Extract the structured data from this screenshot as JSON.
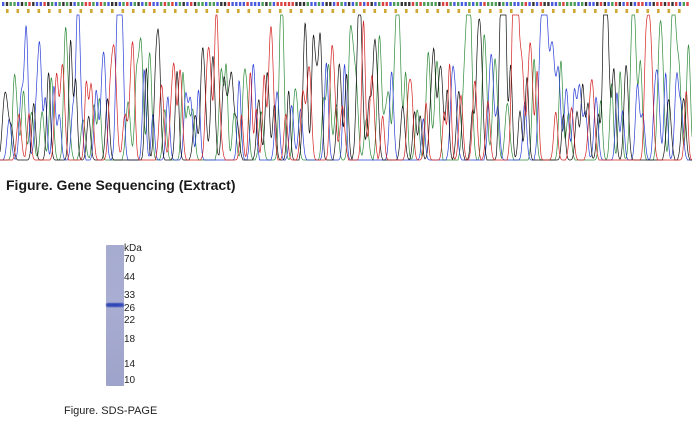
{
  "sequencing": {
    "caption": "Figure. Gene Sequencing (Extract)",
    "colors": {
      "A": "#2e8b3a",
      "C": "#2a3fd6",
      "G": "#111111",
      "T": "#d42222",
      "aa_text": "#c8a020"
    },
    "base_icon": "chromatogram-trace"
  },
  "gel": {
    "caption": "Figure. SDS-PAGE",
    "unit_label": "kDa",
    "markers": [
      "70",
      "44",
      "33",
      "26",
      "22",
      "18",
      "14",
      "10"
    ],
    "band_kda": 30,
    "lane_color": "#a6abd0",
    "band_color": "#2f45b8"
  }
}
